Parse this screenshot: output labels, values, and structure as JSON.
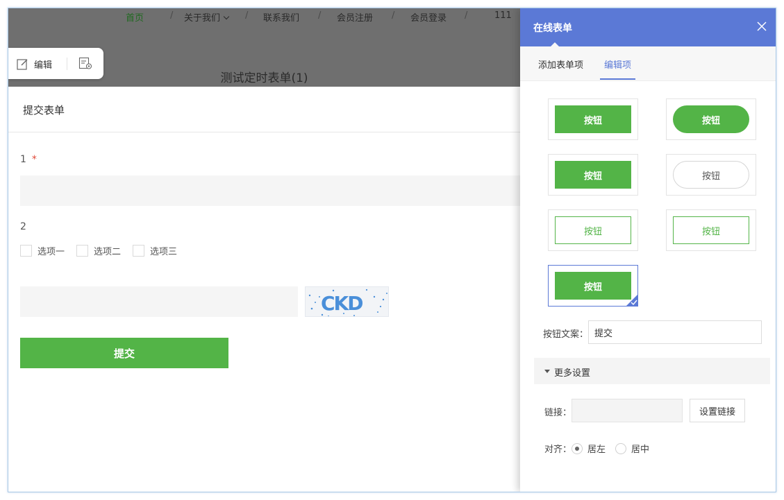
{
  "nav": {
    "items": [
      {
        "label": "首页",
        "active": true
      },
      {
        "label": "关于我们",
        "has_dropdown": true
      },
      {
        "label": "联系我们"
      },
      {
        "label": "会员注册"
      },
      {
        "label": "会员登录"
      },
      {
        "label": "111"
      }
    ],
    "separator": "/"
  },
  "toolbar": {
    "edit_label": "编辑",
    "edit_icon": "edit-icon",
    "settings_icon": "form-settings-icon"
  },
  "page": {
    "title": "测试定时表单(1)"
  },
  "form": {
    "header": "提交表单",
    "q1_number": "1",
    "q1_required_mark": "*",
    "q2_number": "2",
    "options": [
      "选项一",
      "选项二",
      "选项三"
    ],
    "captcha_text": "CKD",
    "submit_label": "提交"
  },
  "panel": {
    "title": "在线表单",
    "tabs": [
      "添加表单项",
      "编辑项"
    ],
    "active_tab": "编辑项",
    "style_button_label": "按钮",
    "button_styles": [
      "solid",
      "pill",
      "solid",
      "pill-outline",
      "outline",
      "outline",
      "solid"
    ],
    "selected_style_index": 6,
    "btn_text_label": "按钮文案：",
    "btn_text_value": "提交",
    "more_settings_label": "更多设置",
    "link_label": "链接：",
    "link_value": "",
    "set_link_label": "设置链接",
    "align_label": "对齐：",
    "align_options": [
      "居左",
      "居中"
    ],
    "align_selected": "居左"
  },
  "colors": {
    "accent_blue": "#5b79d6",
    "button_green": "#53b447",
    "overlay_gray": "#6f6f6f",
    "required_red": "#e04a3a"
  }
}
